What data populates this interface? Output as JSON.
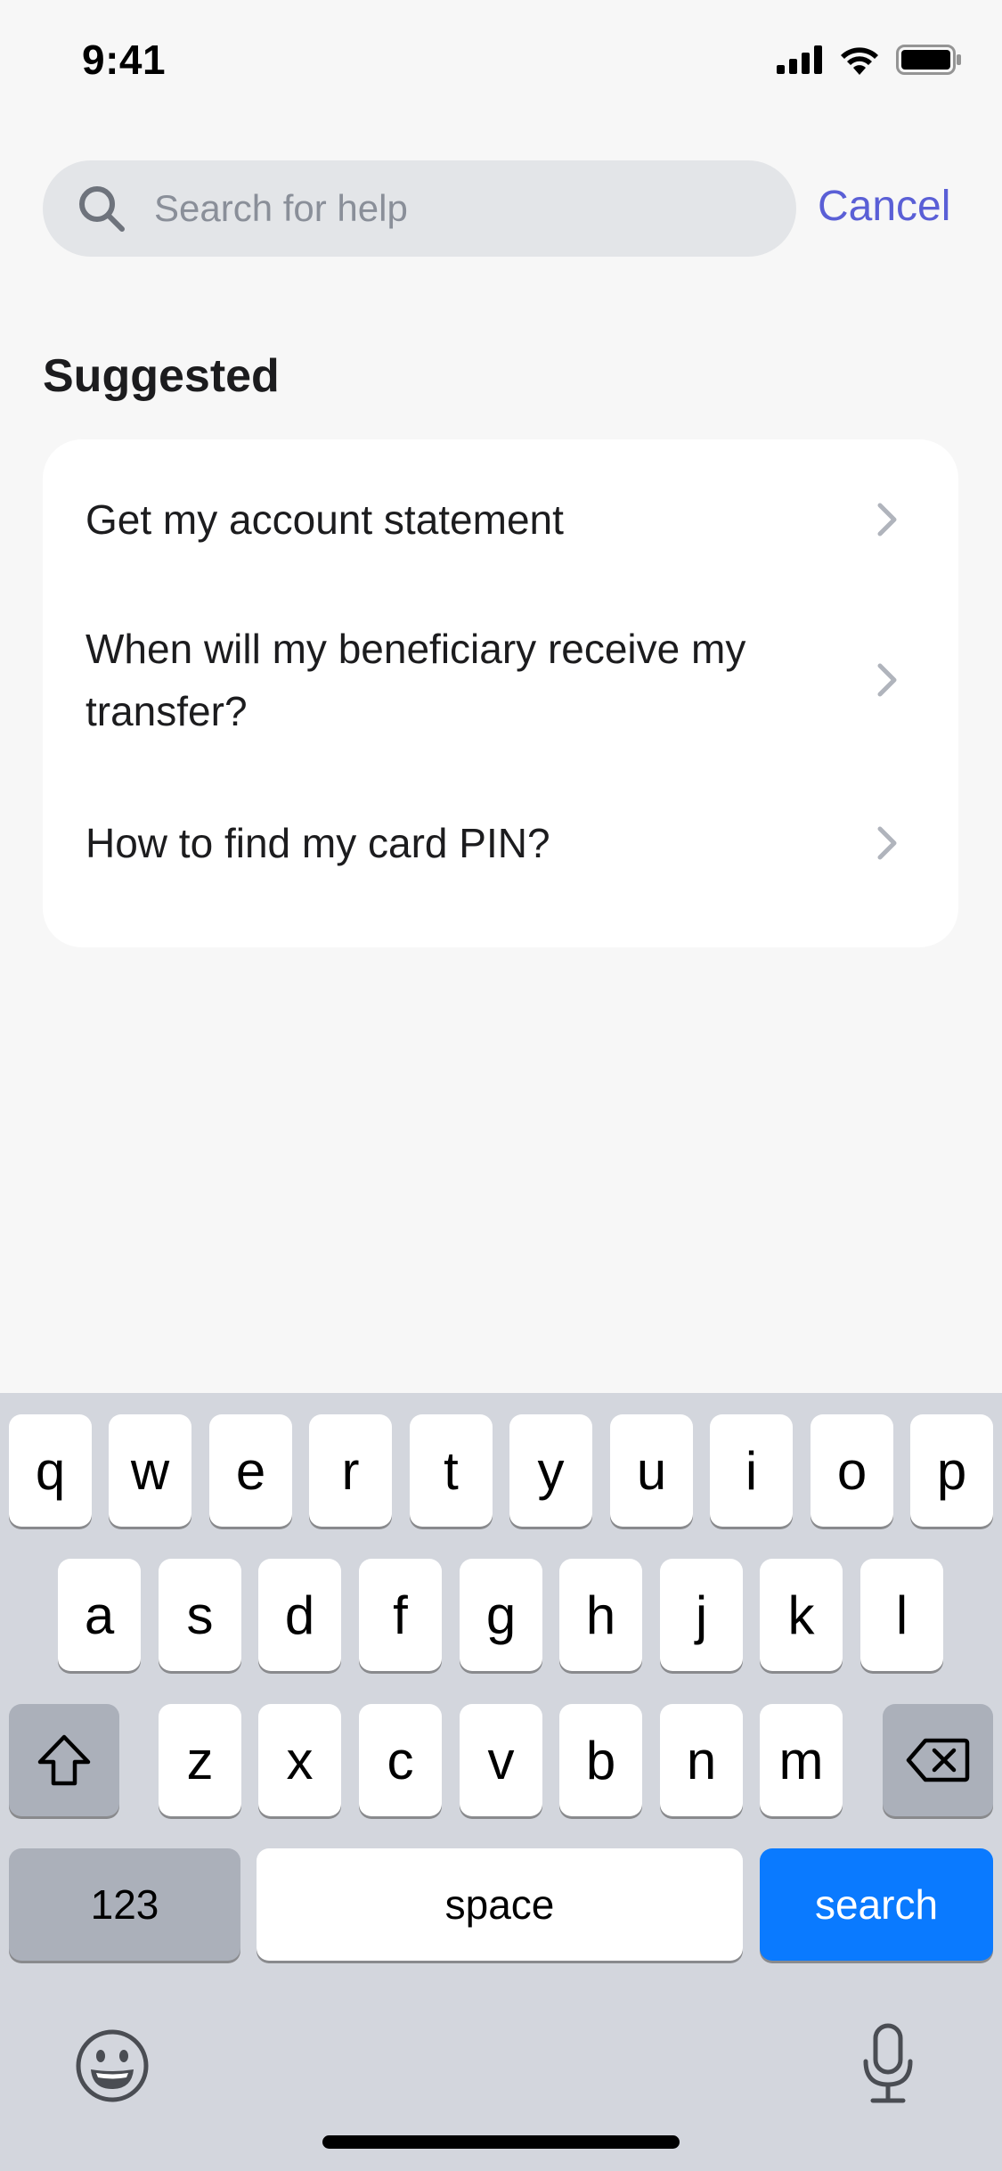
{
  "status_bar": {
    "time": "9:41",
    "icons": [
      "cellular-signal-icon",
      "wifi-icon",
      "battery-icon"
    ]
  },
  "search": {
    "placeholder": "Search for help",
    "value": "",
    "cancel_label": "Cancel",
    "icon": "search-icon"
  },
  "suggested": {
    "title": "Suggested",
    "items": [
      {
        "label": "Get my account statement"
      },
      {
        "label": "When will my beneficiary receive my transfer?"
      },
      {
        "label": "How to find my card PIN?"
      }
    ]
  },
  "keyboard": {
    "row1": [
      "q",
      "w",
      "e",
      "r",
      "t",
      "y",
      "u",
      "i",
      "o",
      "p"
    ],
    "row2": [
      "a",
      "s",
      "d",
      "f",
      "g",
      "h",
      "j",
      "k",
      "l"
    ],
    "row3": [
      "z",
      "x",
      "c",
      "v",
      "b",
      "n",
      "m"
    ],
    "numbers_label": "123",
    "space_label": "space",
    "search_label": "search",
    "icons": [
      "shift-icon",
      "delete-icon",
      "emoji-icon",
      "microphone-icon"
    ]
  },
  "colors": {
    "accent": "#5A5FD6",
    "search_key": "#0A7AFF",
    "background": "#F7F7F7",
    "keyboard": "#D3D6DD"
  }
}
